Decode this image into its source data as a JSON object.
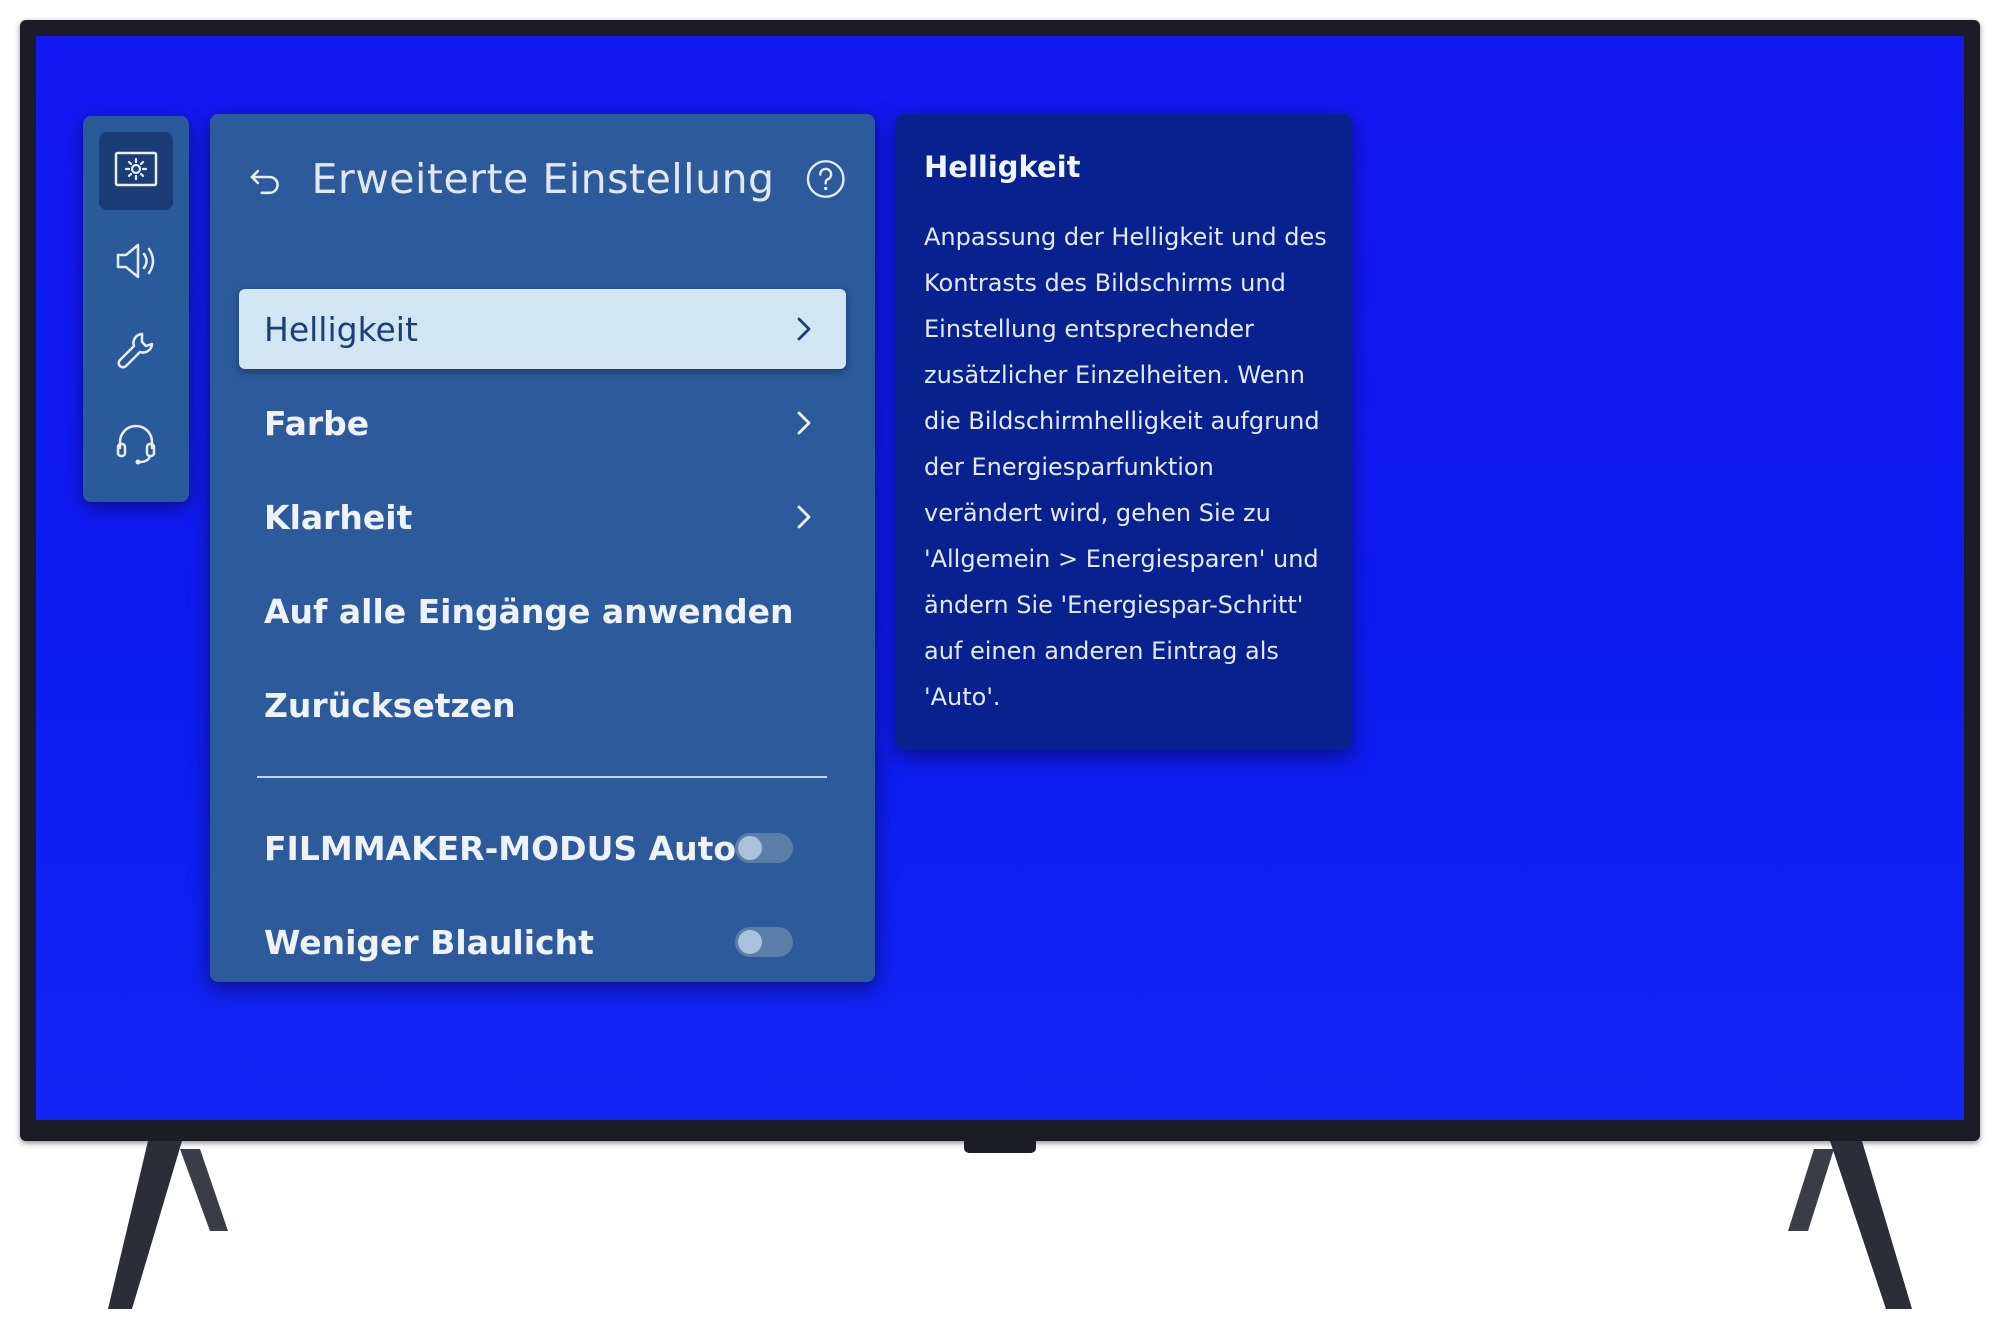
{
  "sidebar": {
    "items": [
      {
        "icon": "picture-settings-icon",
        "active": true
      },
      {
        "icon": "speaker-icon",
        "active": false
      },
      {
        "icon": "wrench-icon",
        "active": false
      },
      {
        "icon": "headset-icon",
        "active": false
      }
    ]
  },
  "menu": {
    "title": "Erweiterte Einstellung",
    "items": [
      {
        "label": "Helligkeit",
        "has_submenu": true,
        "focused": true
      },
      {
        "label": "Farbe",
        "has_submenu": true
      },
      {
        "label": "Klarheit",
        "has_submenu": true
      },
      {
        "label": "Auf alle Eingänge anwenden"
      },
      {
        "label": "Zurücksetzen"
      }
    ],
    "toggles": [
      {
        "label": "FILMMAKER-MODUS Auto-...",
        "on": false
      },
      {
        "label": "Weniger Blaulicht",
        "on": false
      }
    ]
  },
  "info": {
    "title": "Helligkeit",
    "lines": [
      "Anpassung der Helligkeit und des",
      "Kontrasts des Bildschirms und",
      "Einstellung entsprechender",
      "zusätzlicher Einzelheiten. Wenn",
      "die Bildschirmhelligkeit aufgrund",
      "der Energiesparfunktion",
      "verändert wird, gehen Sie zu",
      "'Allgemein > Energiesparen' und",
      "ändern Sie 'Energiespar-Schritt'",
      "auf einen anderen Eintrag als",
      "'Auto'."
    ]
  },
  "colors": {
    "screen_blue": "#1418f2",
    "panel": "#2c5a9b",
    "focus": "#d2e5f3",
    "info_panel": "#07218e"
  }
}
